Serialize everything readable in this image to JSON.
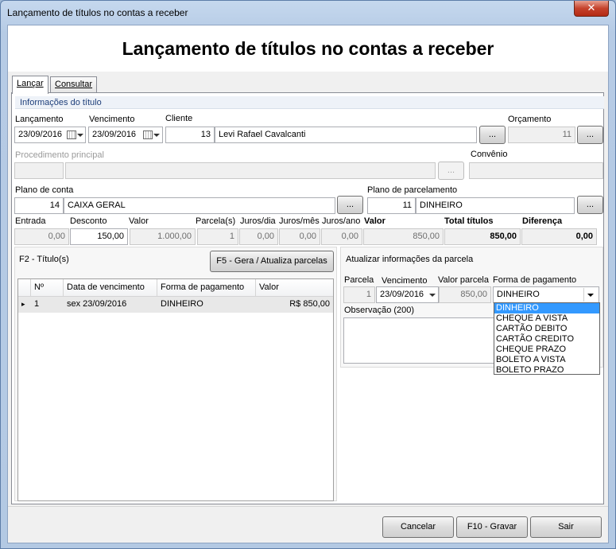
{
  "window": {
    "title": "Lançamento de títulos no contas a receber",
    "close_glyph": "✕"
  },
  "page": {
    "title": "Lançamento de títulos no contas a receber"
  },
  "tabs": [
    {
      "label": "Lançar"
    },
    {
      "label": "Consultar"
    }
  ],
  "section": {
    "caption": "Informações do título"
  },
  "fields": {
    "lancamento": {
      "label": "Lançamento",
      "value": "23/09/2016"
    },
    "vencimento": {
      "label": "Vencimento",
      "value": "23/09/2016"
    },
    "cliente": {
      "label": "Cliente",
      "code": "13",
      "name": "Levi Rafael Cavalcanti"
    },
    "orcamento": {
      "label": "Orçamento",
      "value": "11"
    },
    "procedimento": {
      "label": "Procedimento principal",
      "code": "",
      "name": ""
    },
    "convenio": {
      "label": "Convênio",
      "value": ""
    },
    "plano_conta": {
      "label": "Plano de conta",
      "code": "14",
      "name": "CAIXA GERAL"
    },
    "plano_parcelamento": {
      "label": "Plano de parcelamento",
      "code": "11",
      "name": "DINHEIRO"
    }
  },
  "lookup_label": "...",
  "values_row": {
    "entrada": {
      "label": "Entrada",
      "value": "0,00"
    },
    "desconto": {
      "label": "Desconto",
      "value": "150,00"
    },
    "valor": {
      "label": "Valor",
      "value": "1.000,00"
    },
    "parcelas": {
      "label": "Parcela(s)",
      "value": "1"
    },
    "juros_dia": {
      "label": "Juros/dia",
      "value": "0,00"
    },
    "juros_mes": {
      "label": "Juros/mês",
      "value": "0,00"
    },
    "juros_ano": {
      "label": "Juros/ano",
      "value": "0,00"
    },
    "valor_total": {
      "label": "Valor",
      "value": "850,00"
    },
    "total_titulos": {
      "label": "Total títulos",
      "value": "850,00"
    },
    "diferenca": {
      "label": "Diferença",
      "value": "0,00"
    }
  },
  "titulos": {
    "caption": "F2 - Título(s)",
    "generate_button": "F5 - Gera / Atualiza parcelas",
    "columns": [
      "Nº",
      "Data de vencimento",
      "Forma de pagamento",
      "Valor"
    ],
    "rows": [
      {
        "marker": "▸",
        "n": "1",
        "data": "sex 23/09/2016",
        "forma": "DINHEIRO",
        "valor": "R$ 850,00"
      }
    ]
  },
  "parcela": {
    "caption": "Atualizar informações da parcela",
    "parcela_label": "Parcela",
    "parcela_value": "1",
    "vencimento_label": "Vencimento",
    "vencimento_value": "23/09/2016",
    "valor_label": "Valor parcela",
    "valor_value": "850,00",
    "forma_label": "Forma de pagamento",
    "forma_value": "DINHEIRO",
    "observacao_label": "Observação (200)",
    "observacao_value": "",
    "options": [
      "DINHEIRO",
      "CHEQUE A VISTA",
      "CARTÃO DEBITO",
      "CARTÃO CREDITO",
      "CHEQUE PRAZO",
      "BOLETO A VISTA",
      "BOLETO PRAZO"
    ]
  },
  "footer": {
    "cancel": "Cancelar",
    "save": "F10 - Gravar",
    "exit": "Sair"
  }
}
